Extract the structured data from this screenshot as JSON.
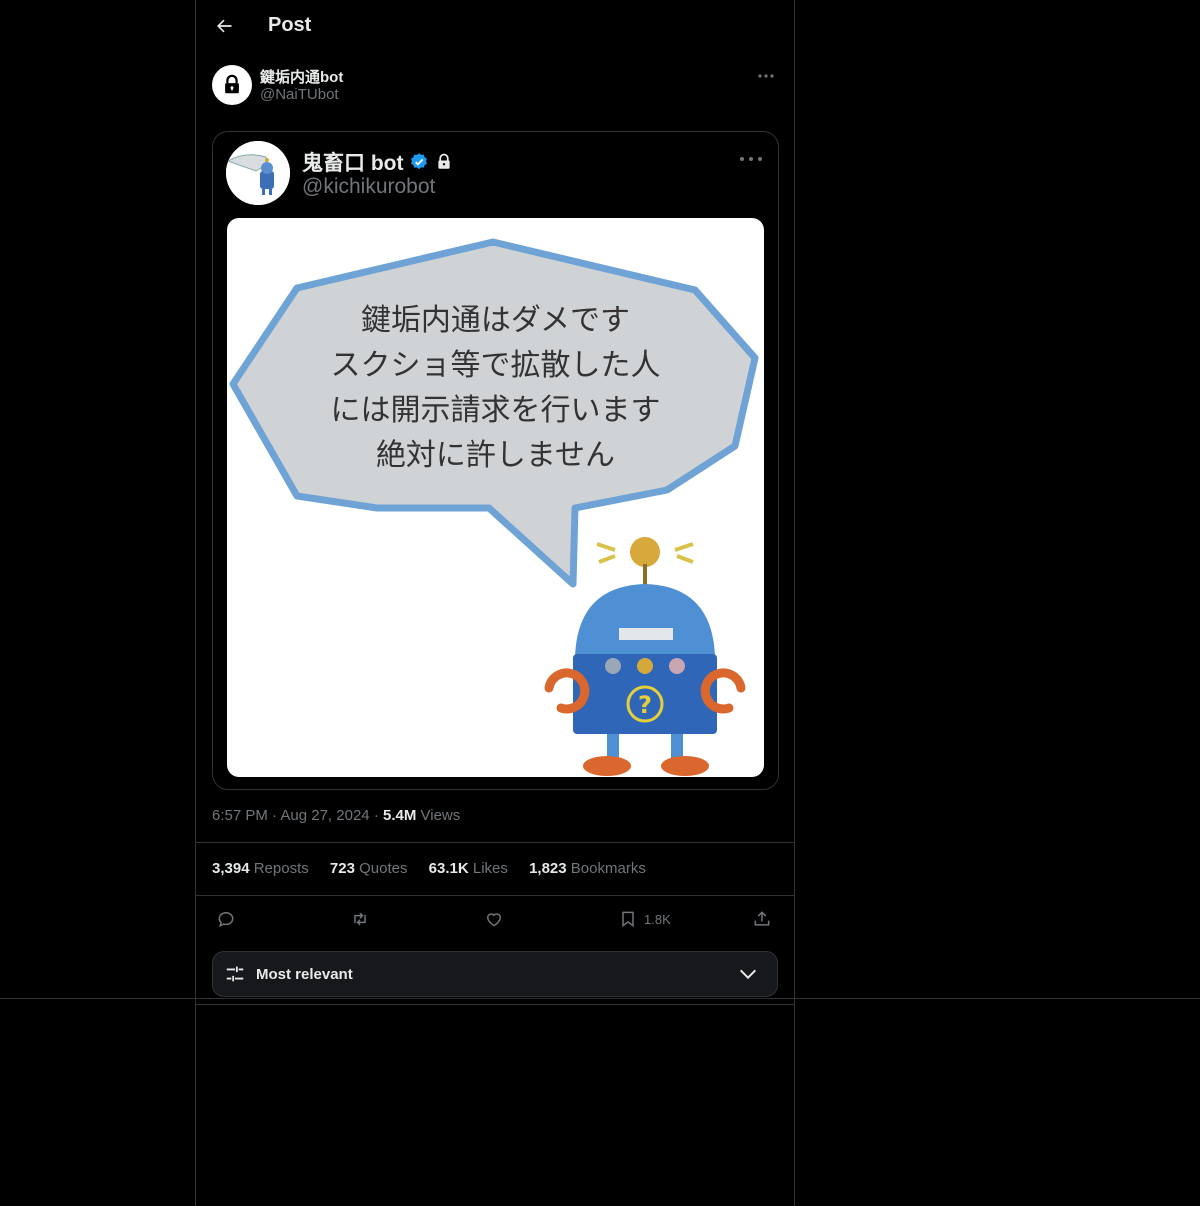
{
  "header": {
    "title": "Post"
  },
  "author": {
    "name": "鍵垢内通bot",
    "handle": "@NaiTUbot"
  },
  "quoted": {
    "name": "鬼畜口 bot",
    "handle": "@kichikurobot",
    "image_text": [
      "鍵垢内通はダメです",
      "スクショ等で拡散した人",
      "には開示請求を行います",
      "絶対に許しません"
    ]
  },
  "meta": {
    "time": "6:57 PM",
    "sep1": "·",
    "date": "Aug 27, 2024",
    "sep2": "·",
    "views_count": "5.4M",
    "views_label": "Views"
  },
  "stats": [
    {
      "count": "3,394",
      "label": "Reposts"
    },
    {
      "count": "723",
      "label": "Quotes"
    },
    {
      "count": "63.1K",
      "label": "Likes"
    },
    {
      "count": "1,823",
      "label": "Bookmarks"
    }
  ],
  "actions": {
    "bookmark_count": "1.8K"
  },
  "sort": {
    "label": "Most relevant"
  },
  "colors": {
    "background": "#000000",
    "border": "#2f3336",
    "muted": "#71767b",
    "verified": "#1d9bf0",
    "bubble_outline": "#6fa3d6"
  },
  "icons": [
    "back-arrow-icon",
    "lock-icon",
    "more-icon",
    "verified-icon",
    "reply-icon",
    "repost-icon",
    "like-icon",
    "bookmark-icon",
    "share-icon",
    "sliders-icon",
    "chevron-down-icon"
  ]
}
